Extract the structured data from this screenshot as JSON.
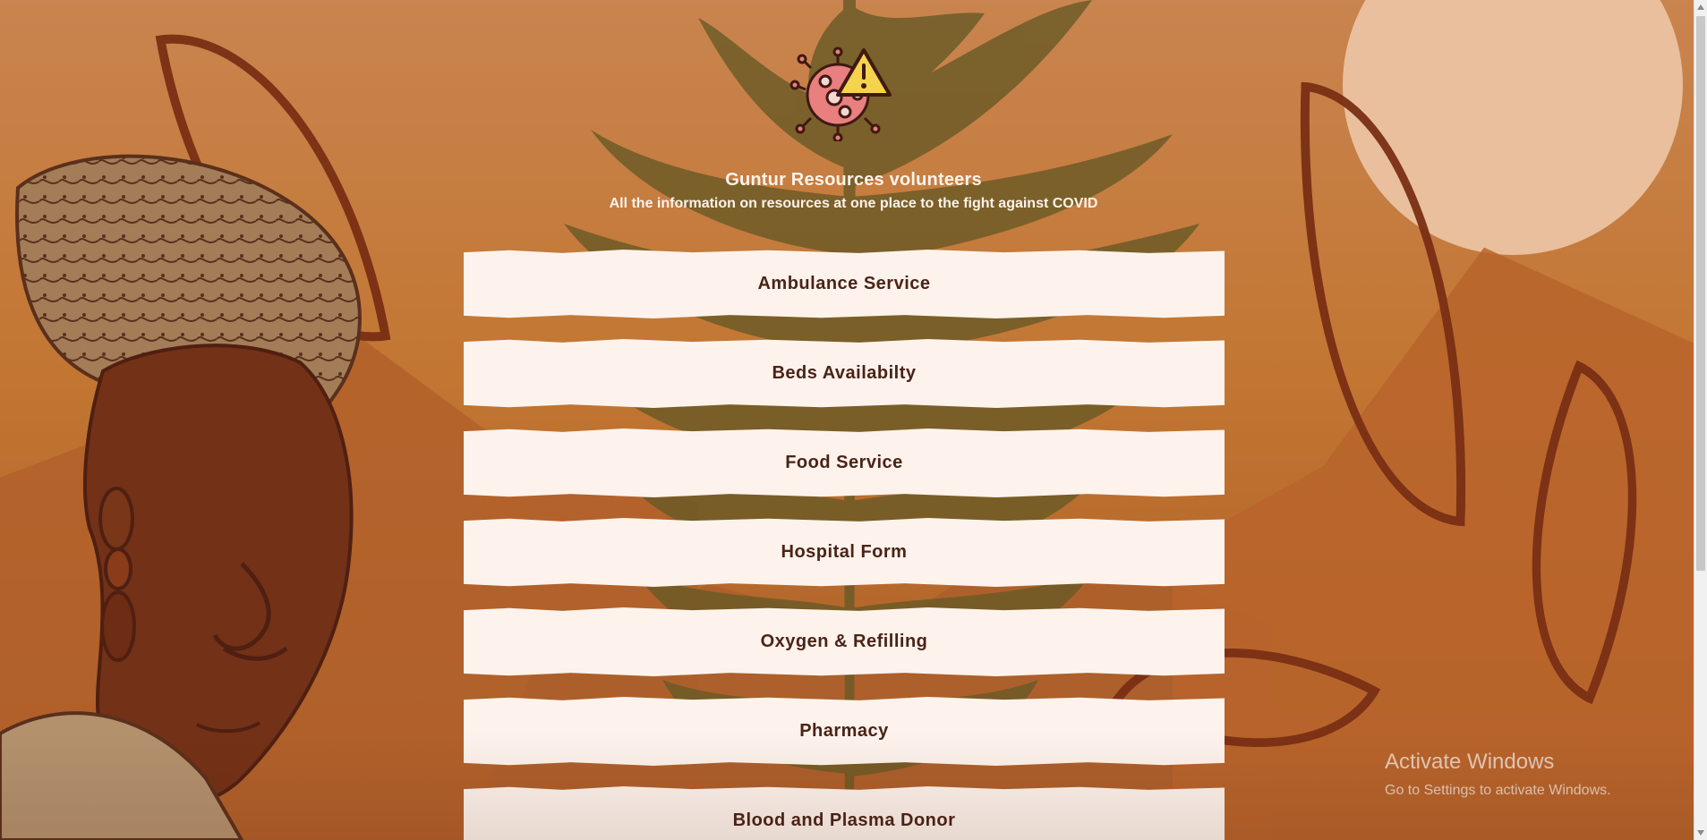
{
  "header": {
    "logo_icon": "virus-warning-icon",
    "title": "Guntur Resources volunteers",
    "subtitle": "All the information on resources at one place to the fight against COVID"
  },
  "menu": {
    "items": [
      {
        "label": "Ambulance Service"
      },
      {
        "label": "Beds Availabilty"
      },
      {
        "label": "Food Service"
      },
      {
        "label": "Hospital Form"
      },
      {
        "label": "Oxygen & Refilling"
      },
      {
        "label": "Pharmacy"
      },
      {
        "label": "Blood and Plasma Donor"
      }
    ]
  },
  "watermark": {
    "line1": "Activate Windows",
    "line2": "Go to Settings to activate Windows."
  },
  "colors": {
    "background": "#c27632",
    "button_bg": "#fdf3ec",
    "button_text": "#4a2317",
    "leaf": "#7a2f14",
    "sun": "#e9bf9d"
  }
}
